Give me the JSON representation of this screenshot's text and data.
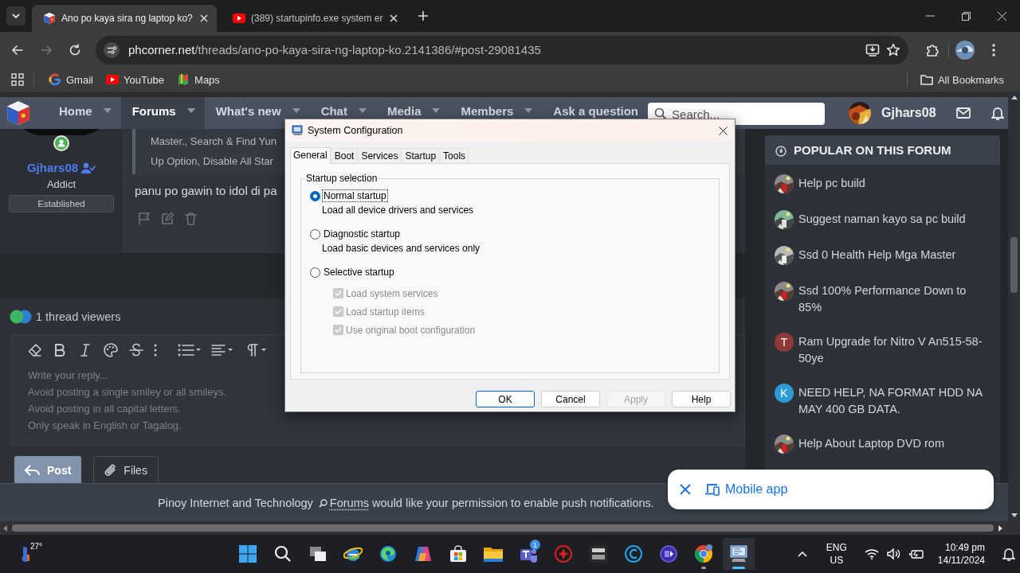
{
  "browser": {
    "tabs": [
      {
        "title": "Ano po kaya sira ng laptop ko?",
        "kind": "forum",
        "selected": true
      },
      {
        "title": "(389) startupinfo.exe system er",
        "kind": "video",
        "selected": false
      }
    ],
    "forward_disabled": true,
    "address": {
      "host": "phcorner.net",
      "path": "/threads/ano-po-kaya-sira-ng-laptop-ko.2141386/#post-29081435"
    },
    "bookmarks": [
      {
        "label": "Gmail",
        "kind": "mail"
      },
      {
        "label": "YouTube",
        "kind": "video"
      },
      {
        "label": "Maps",
        "kind": "map"
      }
    ],
    "all_bookmarks": "All Bookmarks"
  },
  "forum": {
    "nav": [
      {
        "label": "Home",
        "caret": true,
        "selected": false
      },
      {
        "label": "Forums",
        "caret": true,
        "selected": true
      },
      {
        "label": "What's new",
        "caret": true,
        "selected": false
      },
      {
        "label": "Chat",
        "caret": true,
        "selected": false
      },
      {
        "label": "Media",
        "caret": true,
        "selected": false
      },
      {
        "label": "Members",
        "caret": true,
        "selected": false
      },
      {
        "label": "Ask a question",
        "caret": false,
        "selected": false
      }
    ],
    "search": {
      "placeholder": "Search..."
    },
    "user": "Gjhars08",
    "post": {
      "author": "Gjhars08",
      "rank": "Addict",
      "badge": "Established",
      "quote_lines": [
        "Master., Search & Find Yun",
        "Up Option, Disable All Star"
      ],
      "message": "panu po gawin to idol di pa"
    },
    "viewers": "1 thread viewers",
    "editor": {
      "placeholder": "Write your reply...\nAvoid posting a single smiley or all smileys.\nAvoid posting in all capital letters.\nOnly speak in English or Tagalog."
    },
    "buttons": [
      {
        "label": "Post",
        "kind": "primary"
      },
      {
        "label": "Files",
        "kind": "attach"
      }
    ],
    "sidebar": {
      "title": "POPULAR ON THIS FORUM",
      "items": [
        {
          "title": "Help pc build"
        },
        {
          "title": "Suggest naman kayo sa pc build"
        },
        {
          "title": "Ssd 0 Health Help Mga Master"
        },
        {
          "title": "Ssd 100% Performance Down to 85%"
        },
        {
          "title": "Ram Upgrade for Nitro V An515-58-50ye",
          "avatar": {
            "kind": "letter",
            "letter": "T",
            "color": "#8e3a36"
          }
        },
        {
          "title": "NEED HELP, NA FORMAT HDD NA MAY 400 GB DATA.",
          "avatar": {
            "kind": "letter",
            "letter": "K",
            "color": "#2e9bd6"
          }
        },
        {
          "title": "Help About Laptop DVD rom"
        }
      ]
    },
    "push_notice": {
      "before": "Pinoy Internet and Technology",
      "link": "Forums",
      "after": "would like your permission to enable push notifications."
    },
    "mobile_app": {
      "label": "Mobile app"
    }
  },
  "dialog": {
    "title": "System Configuration",
    "tabs": [
      {
        "label": "General",
        "selected": true
      },
      {
        "label": "Boot",
        "selected": false
      },
      {
        "label": "Services",
        "selected": false
      },
      {
        "label": "Startup",
        "selected": false
      },
      {
        "label": "Tools",
        "selected": false
      }
    ],
    "group": "Startup selection",
    "options": [
      {
        "label": "Normal startup",
        "description": "Load all device drivers and services",
        "selected": true
      },
      {
        "label": "Diagnostic startup",
        "description": "Load basic devices and services only",
        "selected": false
      },
      {
        "label": "Selective startup",
        "selected": false
      }
    ],
    "checks": [
      {
        "label": "Load system services",
        "checked": true,
        "disabled": true
      },
      {
        "label": "Load startup items",
        "checked": true,
        "disabled": true
      },
      {
        "label": "Use original boot configuration",
        "checked": true,
        "disabled": true
      }
    ],
    "buttons": [
      {
        "label": "OK",
        "default": true,
        "disabled": false
      },
      {
        "label": "Cancel",
        "default": false,
        "disabled": false
      },
      {
        "label": "Apply",
        "default": false,
        "disabled": true
      },
      {
        "label": "Help",
        "default": false,
        "disabled": false
      }
    ]
  },
  "taskbar": {
    "temperature": "27°",
    "apps": [
      {
        "kind": "start",
        "selected": false,
        "running": false
      },
      {
        "kind": "search",
        "selected": false,
        "running": false
      },
      {
        "kind": "taskview",
        "selected": false,
        "running": false
      },
      {
        "kind": "orbit",
        "selected": false,
        "running": false
      },
      {
        "kind": "swirl",
        "selected": false,
        "running": false
      },
      {
        "kind": "ribbon",
        "selected": false,
        "running": false
      },
      {
        "kind": "store",
        "selected": false,
        "running": false
      },
      {
        "kind": "folder",
        "selected": false,
        "running": false
      },
      {
        "kind": "people",
        "badge": "1",
        "selected": false,
        "running": false
      },
      {
        "kind": "redgear",
        "selected": false,
        "running": false
      },
      {
        "kind": "tile",
        "selected": false,
        "running": false
      },
      {
        "kind": "cring",
        "selected": false,
        "running": false
      },
      {
        "kind": "purple",
        "selected": false,
        "running": false
      },
      {
        "kind": "tricolor",
        "selected": false,
        "running": true
      },
      {
        "kind": "computer",
        "selected": true,
        "running": true
      }
    ],
    "language": [
      "ENG",
      "US"
    ],
    "time": "10:49 pm",
    "date": "14/11/2024"
  }
}
